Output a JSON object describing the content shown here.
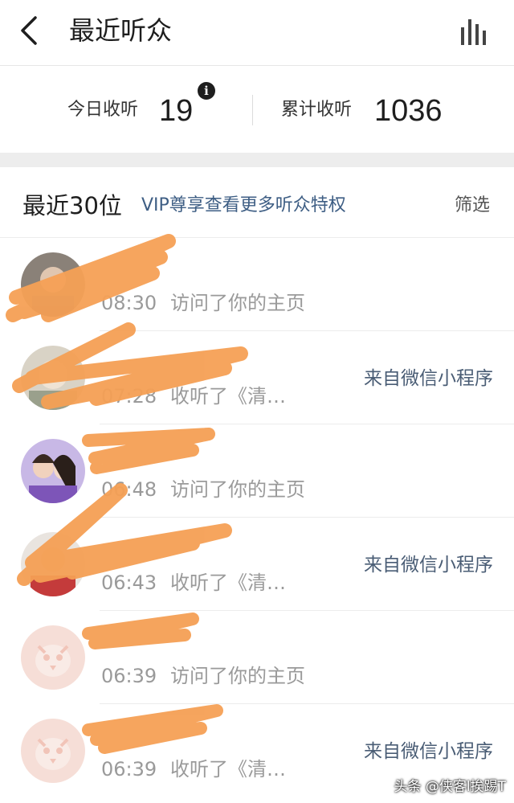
{
  "header": {
    "title": "最近听众",
    "back_icon": "chevron-left-icon",
    "stats_icon": "bar-chart-icon"
  },
  "stats": {
    "today_label": "今日收听",
    "today_value": "19",
    "info_icon_glyph": "i",
    "total_label": "累计收听",
    "total_value": "1036"
  },
  "section": {
    "title": "最近30位",
    "vip_text": "VIP尊享查看更多听众特权",
    "filter_label": "筛选"
  },
  "listeners": [
    {
      "name": "",
      "time": "08:30",
      "action": "访问了你的主页",
      "source": ""
    },
    {
      "name": "",
      "time": "07:28",
      "action": "收听了《清…",
      "source": "来自微信小程序"
    },
    {
      "name": "",
      "time": "06:48",
      "action": "访问了你的主页",
      "source": ""
    },
    {
      "name": "",
      "time": "06:43",
      "action": "收听了《清…",
      "source": "来自微信小程序"
    },
    {
      "name": "",
      "time": "06:39",
      "action": "访问了你的主页",
      "source": ""
    },
    {
      "name": "",
      "time": "06:39",
      "action": "收听了《清…",
      "source": "来自微信小程序"
    }
  ],
  "watermark": "头条 @侠客l挨踢T",
  "colors": {
    "accent_link": "#3e5e84",
    "secondary_text": "#9a9a9a",
    "divider_band": "#ededed",
    "scribble": "#f5a055",
    "default_avatar": "#f6ded7"
  }
}
